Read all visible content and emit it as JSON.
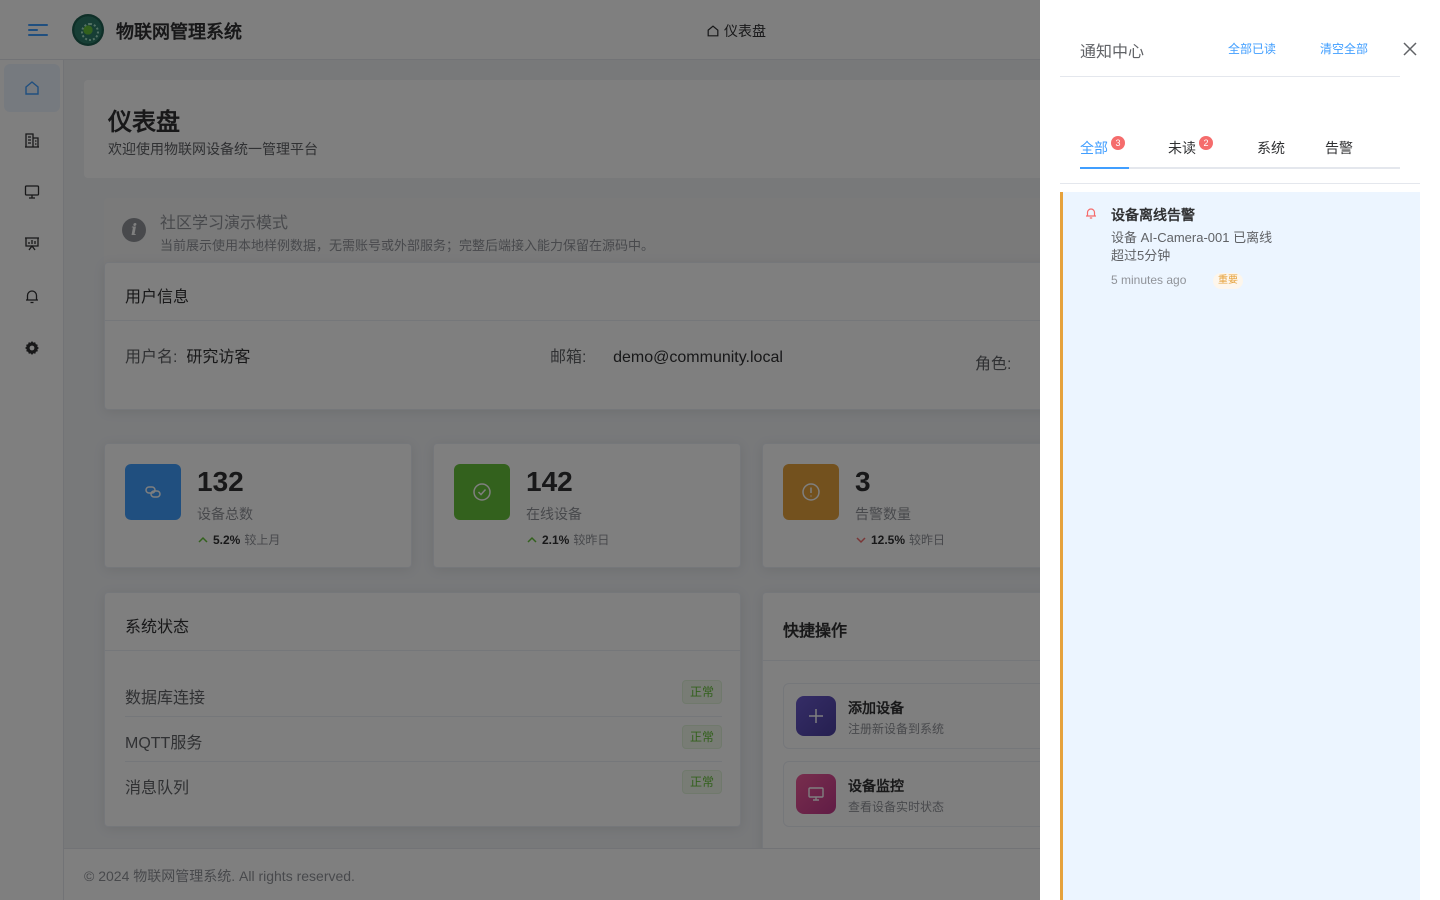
{
  "header": {
    "app_title": "物联网管理系统",
    "breadcrumb": "仪表盘"
  },
  "sidebar": {
    "items": [
      {
        "name": "home",
        "icon": "home-icon"
      },
      {
        "name": "buildings",
        "icon": "building-icon"
      },
      {
        "name": "devices",
        "icon": "monitor-icon"
      },
      {
        "name": "dashboard",
        "icon": "presentation-icon"
      },
      {
        "name": "alerts",
        "icon": "bell-icon"
      },
      {
        "name": "settings",
        "icon": "gear-icon"
      }
    ]
  },
  "page": {
    "title": "仪表盘",
    "subtitle": "欢迎使用物联网设备统一管理平台"
  },
  "notice": {
    "title": "社区学习演示模式",
    "text": "当前展示使用本地样例数据，无需账号或外部服务；完整后端接入能力保留在源码中。"
  },
  "user_card": {
    "title": "用户信息",
    "username_label": "用户名:",
    "username_value": "研究访客",
    "email_label": "邮箱:",
    "email_value": "demo@community.local",
    "role_label": "角色:"
  },
  "stats": [
    {
      "value": "132",
      "label": "设备总数",
      "pct": "5.2%",
      "compare": "较上月",
      "trend": "up",
      "color": "#409eff"
    },
    {
      "value": "142",
      "label": "在线设备",
      "pct": "2.1%",
      "compare": "较昨日",
      "trend": "up",
      "color": "#67c23a"
    },
    {
      "value": "3",
      "label": "告警数量",
      "pct": "12.5%",
      "compare": "较昨日",
      "trend": "down",
      "color": "#e6a23c"
    }
  ],
  "system_status": {
    "title": "系统状态",
    "rows": [
      {
        "name": "数据库连接",
        "status": "正常"
      },
      {
        "name": "MQTT服务",
        "status": "正常"
      },
      {
        "name": "消息队列",
        "status": "正常"
      }
    ]
  },
  "quick_actions": {
    "title": "快捷操作",
    "items": [
      {
        "title": "添加设备",
        "desc": "注册新设备到系统"
      },
      {
        "title": "设备监控",
        "desc": "查看设备实时状态"
      }
    ]
  },
  "footer": {
    "text": "© 2024 物联网管理系统. All rights reserved."
  },
  "drawer": {
    "title": "通知中心",
    "mark_all_read": "全部已读",
    "clear_all": "清空全部",
    "tabs": [
      {
        "label": "全部",
        "badge": "3"
      },
      {
        "label": "未读",
        "badge": "2"
      },
      {
        "label": "系统",
        "badge": ""
      },
      {
        "label": "告警",
        "badge": ""
      }
    ],
    "notifications": [
      {
        "title": "设备离线告警",
        "body": "设备 AI-Camera-001 已离线超过5分钟",
        "time": "5 minutes ago",
        "tag": "重要"
      }
    ]
  }
}
